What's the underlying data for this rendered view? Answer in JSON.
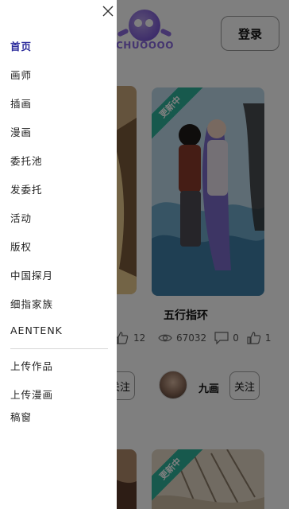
{
  "header": {
    "logo_text": "CHUOOOO",
    "login_label": "登录"
  },
  "cards": [
    {
      "badge": "更新中",
      "title": "五行指环",
      "views": "67032",
      "comments": "0",
      "likes": "1",
      "author": "九画",
      "follow_label": "关注"
    }
  ],
  "left_card": {
    "likes": "12",
    "follow_label": "关注"
  },
  "bottom_card": {
    "badge": "更新中"
  },
  "drawer": {
    "items": [
      {
        "label": "首页"
      },
      {
        "label": "画师"
      },
      {
        "label": "插画"
      },
      {
        "label": "漫画"
      },
      {
        "label": "委托池"
      },
      {
        "label": "发委托"
      },
      {
        "label": "活动"
      },
      {
        "label": "版权"
      },
      {
        "label": "中国探月"
      },
      {
        "label": "细指家族"
      },
      {
        "label": "AENTENK"
      }
    ],
    "secondary_items": [
      {
        "label": "上传作品"
      },
      {
        "label": "上传漫画"
      },
      {
        "label": "稿窗"
      }
    ],
    "active_index": 0
  },
  "colors": {
    "active_menu": "#2c2c9c",
    "ribbon": "#2fb39a",
    "overlay": "rgba(0,0,0,0.5)"
  }
}
